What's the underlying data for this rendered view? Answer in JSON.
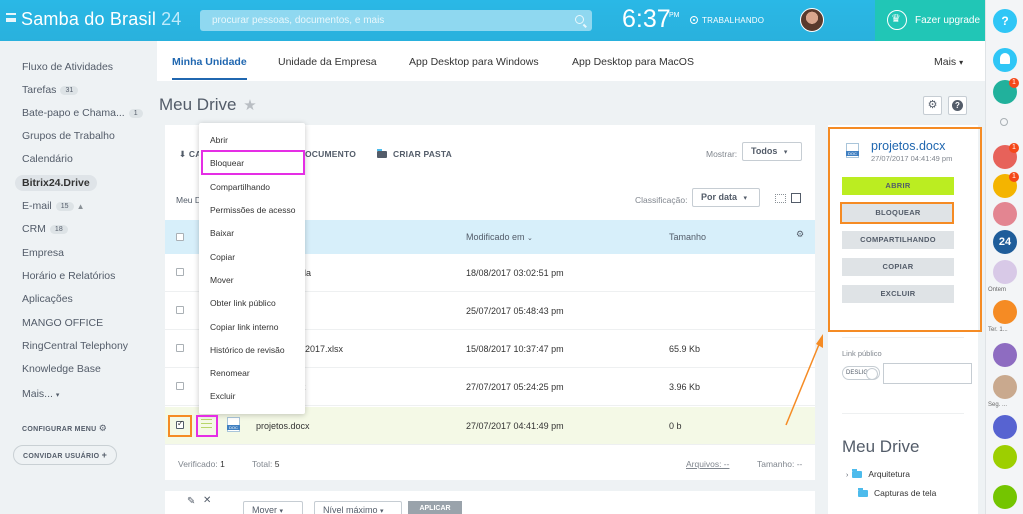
{
  "topbar": {
    "brand": "Samba do Brasil",
    "brand_num": "24",
    "search_placeholder": "procurar pessoas, documentos, e mais",
    "clock": "6:37",
    "ampm": "PM",
    "status": "TRABALHANDO",
    "upgrade": "Fazer upgrade"
  },
  "sidebar": {
    "items": [
      {
        "label": "Fluxo de Atividades"
      },
      {
        "label": "Tarefas",
        "count": "31"
      },
      {
        "label": "Bate-papo e Chama...",
        "count": "1"
      },
      {
        "label": "Grupos de Trabalho"
      },
      {
        "label": "Calendário"
      },
      {
        "label": "Bitrix24.Drive"
      },
      {
        "label": "E-mail",
        "count": "15"
      },
      {
        "label": "CRM",
        "count": "18"
      },
      {
        "label": "Empresa"
      },
      {
        "label": "Horário e Relatórios"
      },
      {
        "label": "Aplicações"
      },
      {
        "label": "MANGO OFFICE"
      },
      {
        "label": "RingCentral Telephony"
      },
      {
        "label": "Knowledge Base"
      },
      {
        "label": "Mais..."
      }
    ],
    "configure": "CONFIGURAR MENU",
    "invite": "CONVIDAR USUÁRIO"
  },
  "tabs": [
    "Minha Unidade",
    "Unidade da Empresa",
    "App Desktop para Windows",
    "App Desktop para MacOS"
  ],
  "tabs_more": "Mais",
  "page_title": "Meu Drive",
  "toolbar": {
    "upload": "CA",
    "document": "OCUMENTO",
    "new_folder": "CRIAR PASTA",
    "show_label": "Mostrar:",
    "show_value": "Todos",
    "breadcrumb": "Meu D",
    "sort_label": "Classificação:",
    "sort_value": "Por data"
  },
  "table": {
    "col_modified": "Modificado em",
    "col_size": "Tamanho",
    "rows": [
      {
        "name": "e tela",
        "modified": "18/08/2017 03:02:51 pm",
        "size": ""
      },
      {
        "name": "",
        "modified": "25/07/2017 05:48:43 pm",
        "size": ""
      },
      {
        "name": "2017.xlsx",
        "modified": "15/08/2017 10:37:47 pm",
        "size": "65.9 Kb"
      },
      {
        "name": "x",
        "modified": "27/07/2017 05:24:25 pm",
        "size": "3.96 Kb"
      },
      {
        "name": "projetos.docx",
        "modified": "27/07/2017 04:41:49 pm",
        "size": "0 b"
      }
    ]
  },
  "footer": {
    "checked_label": "Verificado:",
    "checked_value": "1",
    "total_label": "Total:",
    "total_value": "5",
    "files_label": "Arquivos: --",
    "size_label": "Tamanho: --"
  },
  "bottombar": {
    "move": "Mover",
    "level": "Nível máximo",
    "apply": "APLICAR"
  },
  "context_menu": [
    "Abrir",
    "Bloquear",
    "Compartilhando",
    "Permissões de acesso",
    "Baixar",
    "Copiar",
    "Mover",
    "Obter link público",
    "Copiar link interno",
    "Histórico de revisão",
    "Renomear",
    "Excluir"
  ],
  "right_panel": {
    "file_name": "projetos.docx",
    "file_date": "27/07/2017 04:41:49 pm",
    "buttons": [
      "ABRIR",
      "BLOQUEAR",
      "COMPARTILHANDO",
      "COPIAR",
      "EXCLUIR"
    ],
    "public_link": "Link público",
    "toggle": "DESLIG.",
    "drive_title": "Meu Drive",
    "tree": [
      "Arquitetura",
      "Capturas de tela"
    ]
  },
  "dock": {
    "help": "?",
    "caption_yesterday": "Ontem",
    "caption_ter": "Ter. 1...",
    "caption_seg": "Seg. ..."
  },
  "colors": {
    "accent": "#2067b0",
    "topbar": "#2ab8e6",
    "upgrade": "#21c6b6",
    "highlight_magenta": "#e52ee5",
    "highlight_orange": "#f58b24",
    "open_button": "#bbed21"
  }
}
